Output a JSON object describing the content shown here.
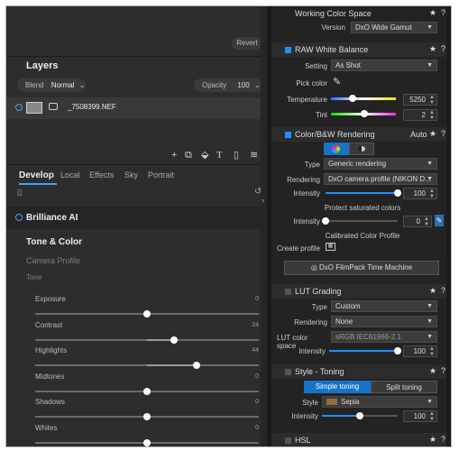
{
  "left": {
    "revert_label": "Revert",
    "layers": {
      "title": "Layers",
      "blend_label": "Blend",
      "blend_value": "Normal",
      "opacity_label": "Opacity",
      "opacity_value": "100",
      "layer_name": "_7508399.NEF"
    },
    "tabs": [
      "Develop",
      "Local",
      "Effects",
      "Sky",
      "Portrait"
    ],
    "brilliance": "Brilliance AI",
    "tone_color": "Tone & Color",
    "camera_profile": "Camera Profile",
    "tone": "Tone",
    "sliders": [
      {
        "label": "Exposure",
        "value": "0",
        "pos": 0.5
      },
      {
        "label": "Contrast",
        "value": "24",
        "pos": 0.62
      },
      {
        "label": "Highlights",
        "value": "44",
        "pos": 0.72
      },
      {
        "label": "Midtones",
        "value": "0",
        "pos": 0.5
      },
      {
        "label": "Shadows",
        "value": "0",
        "pos": 0.5
      },
      {
        "label": "Whites",
        "value": "0",
        "pos": 0.5
      }
    ]
  },
  "right": {
    "wcs": {
      "title": "Working Color Space",
      "version_label": "Version",
      "version_value": "DxO Wide Gamut"
    },
    "rwb": {
      "title": "RAW White Balance",
      "setting_label": "Setting",
      "setting_value": "As Shot",
      "pick_label": "Pick color",
      "temp_label": "Temperature",
      "temp_value": "5250",
      "temp_pos": 0.34,
      "tint_label": "Tint",
      "tint_value": "2",
      "tint_pos": 0.52
    },
    "cbw": {
      "title": "Color/B&W Rendering",
      "auto_label": "Auto",
      "type_label": "Type",
      "type_value": "Generic rendering",
      "rendering_label": "Rendering",
      "rendering_value": "DxO camera profile (NIKON D...",
      "intensity_label": "Intensity",
      "intensity_value": "100",
      "intensity_pos": 1.0,
      "protect_label": "Protect saturated colors",
      "protect_intensity_value": "0",
      "protect_pos": 0.0,
      "calibrated_label": "Calibrated Color Profile",
      "create_profile_label": "Create profile",
      "filmpack_label": "DxO FilmPack Time Machine"
    },
    "lut": {
      "title": "LUT Grading",
      "type_label": "Type",
      "type_value": "Custom",
      "rendering_label": "Rendering",
      "rendering_value": "None",
      "lcs_label": "LUT color space",
      "lcs_value": "sRGB IEC61966-2.1",
      "intensity_label": "Intensity",
      "intensity_value": "100",
      "intensity_pos": 1.0
    },
    "toning": {
      "title": "Style - Toning",
      "simple_label": "Simple toning",
      "split_label": "Split toning",
      "style_label": "Style",
      "style_value": "Sepia",
      "style_color": "#9b6a3a",
      "intensity_label": "Intensity",
      "intensity_value": "100",
      "intensity_pos": 0.5
    },
    "hsl_title": "HSL",
    "star": "★",
    "help": "?"
  },
  "colors": {
    "accent": "#1e90ff",
    "panel": "#2d2d2d",
    "panel_right": "#232323"
  }
}
